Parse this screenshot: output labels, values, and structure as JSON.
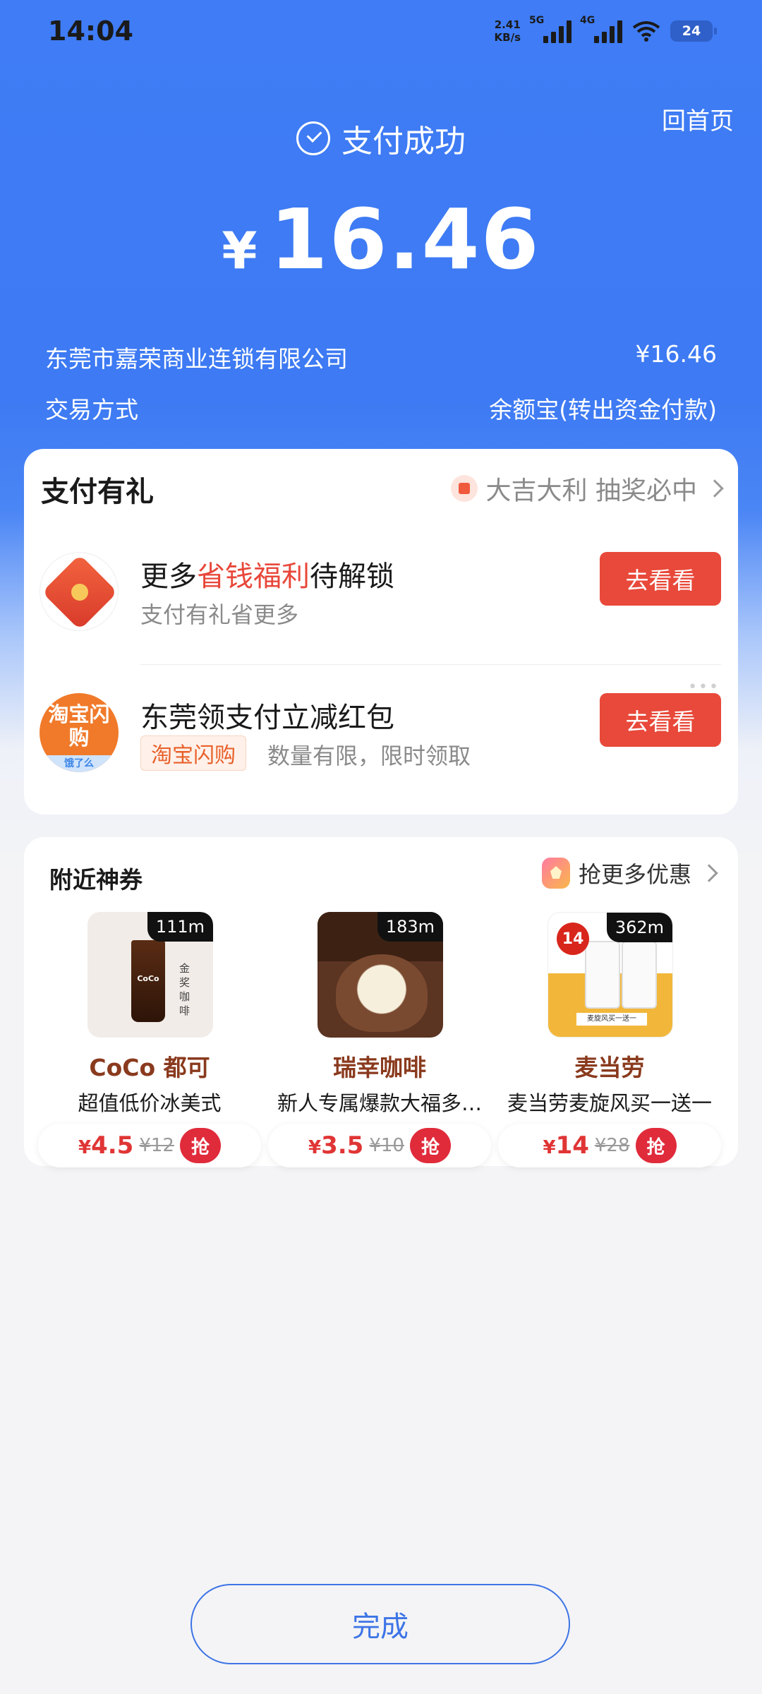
{
  "status_bar": {
    "time": "14:04",
    "net_speed_value": "2.41",
    "net_speed_unit": "KB/s",
    "signal1_label": "5G",
    "signal2_label": "4G",
    "battery": "24"
  },
  "header": {
    "home_label": "回首页",
    "success_text": "支付成功",
    "currency_symbol": "¥",
    "amount": "16.46"
  },
  "details": {
    "merchant": "东莞市嘉荣商业连锁有限公司",
    "merchant_amount": "¥16.46",
    "method_label": "交易方式",
    "method_value": "余额宝(转出资金付款)"
  },
  "gift_section": {
    "title": "支付有礼",
    "lottery_text": "大吉大利 抽奖必中",
    "offers": [
      {
        "title_prefix": "更多",
        "title_highlight": "省钱福利",
        "title_suffix": "待解锁",
        "subtitle": "支付有礼省更多",
        "button": "去看看"
      },
      {
        "title": "东莞领支付立减红包",
        "logo_text": "淘宝闪购",
        "logo_sub": "饿了么",
        "tag": "淘宝闪购",
        "subtitle": "数量有限，限时领取",
        "button": "去看看"
      }
    ]
  },
  "coupon_section": {
    "title": "附近神券",
    "more_label": "抢更多优惠",
    "coupons": [
      {
        "distance": "111m",
        "brand": "CoCo 都可",
        "desc": "超值低价冰美式",
        "yen": "¥",
        "price": "4.5",
        "old_price": "¥12",
        "grab": "抢",
        "thumb_label": "CoCo",
        "thumb_side_text": "金奖咖啡"
      },
      {
        "distance": "183m",
        "brand": "瑞幸咖啡",
        "desc": "新人专属爆款大福多…",
        "yen": "¥",
        "price": "3.5",
        "old_price": "¥10",
        "grab": "抢"
      },
      {
        "distance": "362m",
        "brand": "麦当劳",
        "desc": "麦当劳麦旋风买一送一",
        "yen": "¥",
        "price": "14",
        "old_price": "¥28",
        "grab": "抢",
        "thumb_badge": "14",
        "thumb_strip": "麦旋风买一送一"
      }
    ]
  },
  "footer": {
    "done_label": "完成"
  },
  "colors": {
    "brand_blue": "#3f7cf5",
    "action_red": "#e8493a",
    "price_red": "#e03535"
  }
}
